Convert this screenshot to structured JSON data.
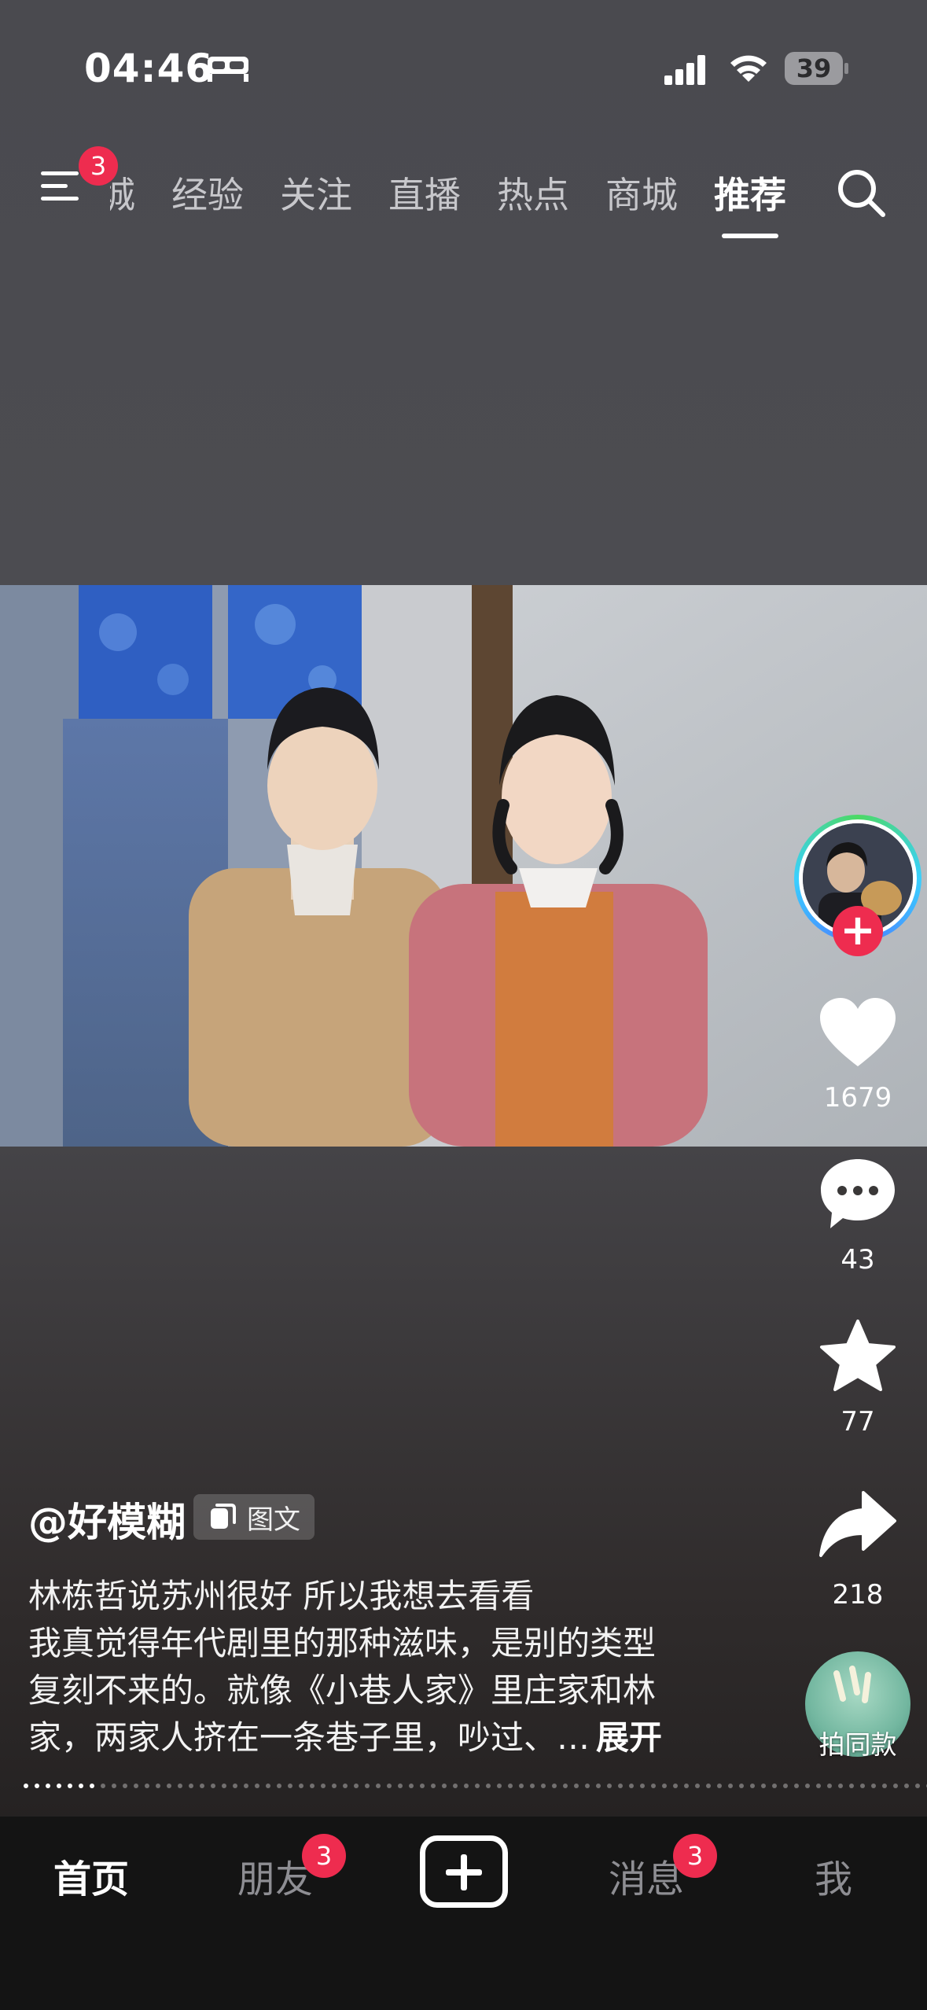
{
  "status_bar": {
    "time": "04:46",
    "battery": "39"
  },
  "top_nav": {
    "menu_badge": "3",
    "tabs": [
      {
        "label": "城"
      },
      {
        "label": "经验"
      },
      {
        "label": "关注"
      },
      {
        "label": "直播"
      },
      {
        "label": "热点"
      },
      {
        "label": "商城"
      },
      {
        "label": "推荐"
      }
    ],
    "active_tab": "推荐"
  },
  "post": {
    "author": "@好模糊",
    "type_badge": "图文",
    "caption_lines": [
      "林栋哲说苏州很好   所以我想去看看",
      "我真觉得年代剧里的那种滋味，是别的类型",
      "复刻不来的。就像《小巷人家》里庄家和林",
      "家，两家人挤在一条巷子里，吵过、…"
    ],
    "expand_label": "展开",
    "image_progress": {
      "current": 7,
      "total": 90
    }
  },
  "actions": {
    "likes": "1679",
    "comments": "43",
    "favorites": "77",
    "shares": "218",
    "remix_label": "拍同款",
    "follow_symbol": "+"
  },
  "tab_bar": {
    "home": "首页",
    "friends": "朋友",
    "friends_badge": "3",
    "messages": "消息",
    "messages_badge": "3",
    "me": "我"
  },
  "colors": {
    "accent_red": "#ee2c4f",
    "tabbar_bg": "#141414"
  }
}
